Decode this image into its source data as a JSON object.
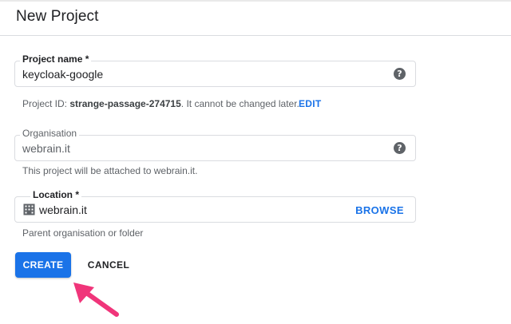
{
  "header": {
    "title": "New Project"
  },
  "project_name": {
    "label": "Project name *",
    "value": "keycloak-google",
    "help_icon": "help-icon"
  },
  "project_id": {
    "prefix": "Project ID: ",
    "id": "strange-passage-274715",
    "suffix": ". It cannot be changed later.",
    "edit_label": "EDIT"
  },
  "organisation": {
    "label": "Organisation",
    "value": "webrain.it",
    "help_icon": "help-icon",
    "hint": "This project will be attached to webrain.it."
  },
  "location": {
    "label": "Location *",
    "value": "webrain.it",
    "icon": "building-icon",
    "browse_label": "BROWSE",
    "hint": "Parent organisation or folder"
  },
  "actions": {
    "create_label": "CREATE",
    "cancel_label": "CANCEL"
  },
  "colors": {
    "accent": "#1a73e8",
    "annotation_arrow": "#f0357a"
  }
}
